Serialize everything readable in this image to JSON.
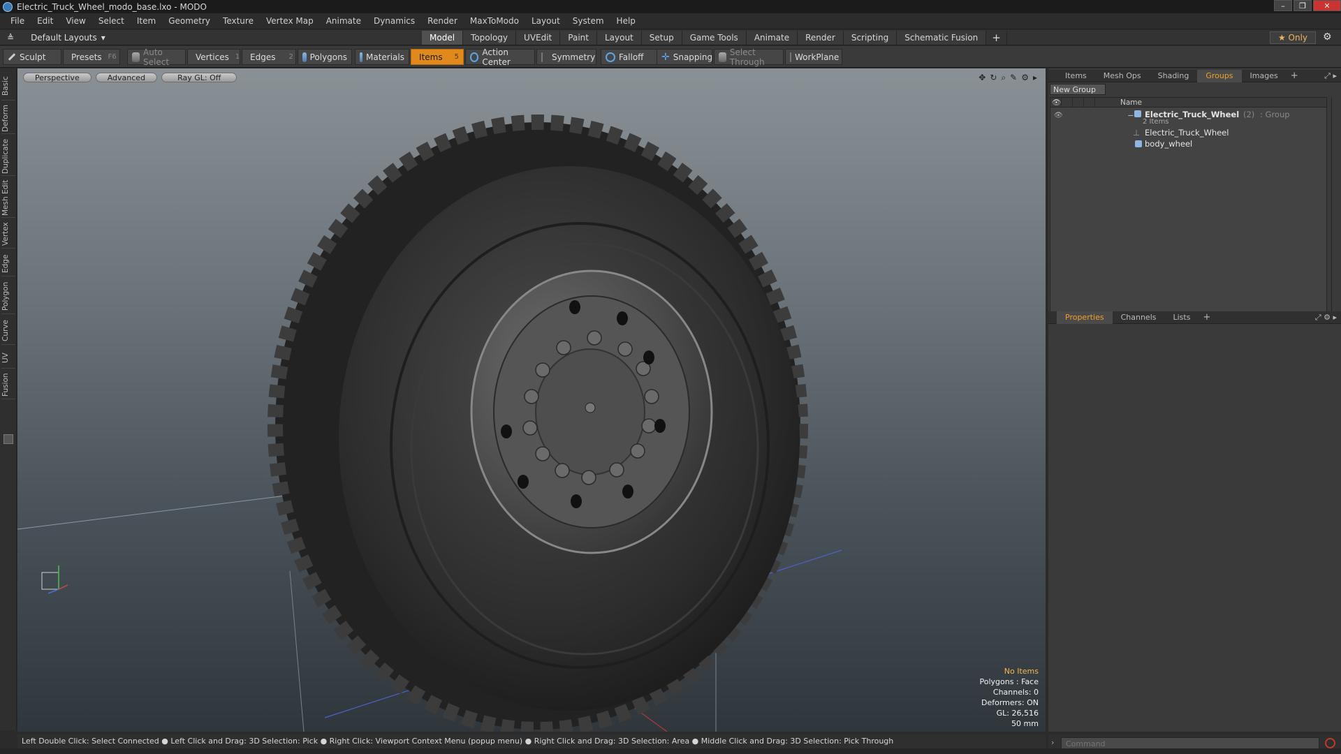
{
  "window": {
    "title": "Electric_Truck_Wheel_modo_base.lxo - MODO"
  },
  "menu": [
    "File",
    "Edit",
    "View",
    "Select",
    "Item",
    "Geometry",
    "Texture",
    "Vertex Map",
    "Animate",
    "Dynamics",
    "Render",
    "MaxToModo",
    "Layout",
    "System",
    "Help"
  ],
  "layout": {
    "selector": "Default Layouts",
    "tabs": [
      "Model",
      "Topology",
      "UVEdit",
      "Paint",
      "Layout",
      "Setup",
      "Game Tools",
      "Animate",
      "Render",
      "Scripting",
      "Schematic Fusion"
    ],
    "active_tab": "Model",
    "plus": "+",
    "only_label": "Only"
  },
  "toolbar": {
    "sculpt": "Sculpt",
    "presets": "Presets",
    "presets_key": "F6",
    "auto_select": "Auto Select",
    "vertices": "Vertices",
    "vertices_num": "1",
    "edges": "Edges",
    "edges_num": "2",
    "polygons": "Polygons",
    "materials": "Materials",
    "items": "Items",
    "items_num": "5",
    "action_center": "Action Center",
    "symmetry": "Symmetry",
    "falloff": "Falloff",
    "snapping": "Snapping",
    "select_through": "Select Through",
    "workplane": "WorkPlane"
  },
  "left_tabs": [
    "Basic",
    "Deform",
    "Duplicate",
    "Mesh Edit",
    "Vertex",
    "Edge",
    "Polygon",
    "Curve",
    "UV",
    "Fusion"
  ],
  "viewport": {
    "buttons": [
      "Perspective",
      "Advanced",
      "Ray GL: Off"
    ],
    "stats": {
      "selection": "No Items",
      "polygons": "Polygons : Face",
      "channels": "Channels: 0",
      "deformers": "Deformers: ON",
      "gl": "GL: 26,516",
      "scale": "50 mm"
    }
  },
  "groups_panel": {
    "tabs": [
      "Items",
      "Mesh Ops",
      "Shading",
      "Groups",
      "Images"
    ],
    "active_tab": "Groups",
    "new_group": "New Group",
    "column_name": "Name",
    "group_name": "Electric_Truck_Wheel",
    "group_count": "(2)",
    "group_type": ": Group",
    "group_sub": "2 Items",
    "children": [
      "Electric_Truck_Wheel",
      "body_wheel"
    ]
  },
  "properties_panel": {
    "tabs": [
      "Properties",
      "Channels",
      "Lists"
    ],
    "active_tab": "Properties"
  },
  "statusbar": {
    "hint": "Left Double Click: Select Connected ● Left Click and Drag: 3D Selection: Pick ● Right Click: Viewport Context Menu (popup menu) ● Right Click and Drag: 3D Selection: Area ● Middle Click and Drag: 3D Selection: Pick Through"
  },
  "command": {
    "placeholder": "Command"
  },
  "colors": {
    "accent": "#e08a1e",
    "highlight_text": "#f0a030",
    "background": "#3a3a3a"
  }
}
